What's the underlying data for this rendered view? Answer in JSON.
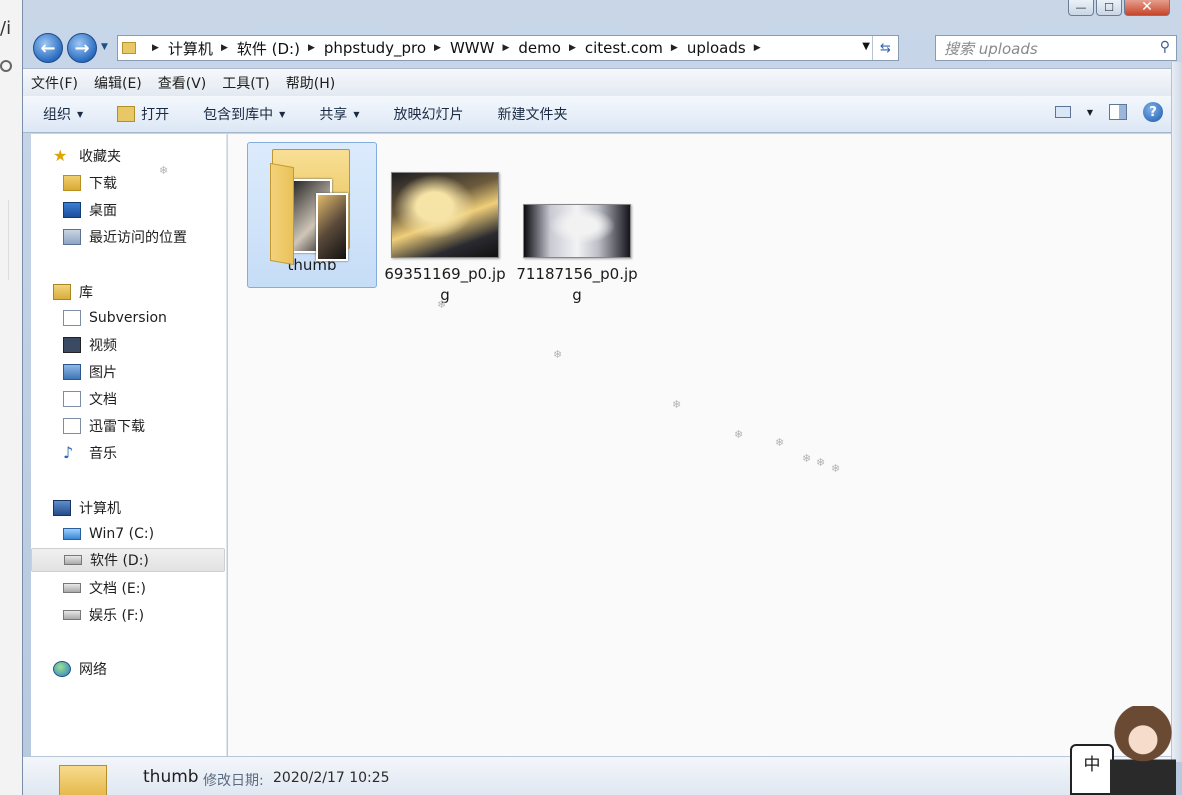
{
  "window": {
    "caption": {
      "minimize": "—",
      "maximize": "☐",
      "close": "✕"
    }
  },
  "address": {
    "crumbs": [
      "计算机",
      "软件 (D:)",
      "phpstudy_pro",
      "WWW",
      "demo",
      "citest.com",
      "uploads"
    ],
    "search_placeholder": "搜索 uploads"
  },
  "menu": {
    "items": [
      "文件(F)",
      "编辑(E)",
      "查看(V)",
      "工具(T)",
      "帮助(H)"
    ]
  },
  "commands": {
    "organize": "组织",
    "open": "打开",
    "include_library": "包含到库中",
    "share": "共享",
    "slideshow": "放映幻灯片",
    "new_folder": "新建文件夹"
  },
  "nav": {
    "favorites": {
      "title": "收藏夹",
      "items": [
        "下载",
        "桌面",
        "最近访问的位置"
      ]
    },
    "libraries": {
      "title": "库",
      "items": [
        "Subversion",
        "视频",
        "图片",
        "文档",
        "迅雷下载",
        "音乐"
      ]
    },
    "computer": {
      "title": "计算机",
      "items": [
        "Win7 (C:)",
        "软件 (D:)",
        "文档 (E:)",
        "娱乐 (F:)"
      ],
      "selected": "软件 (D:)"
    },
    "network": {
      "title": "网络"
    }
  },
  "files": [
    {
      "name": "thumb",
      "type": "folder",
      "selected": true
    },
    {
      "name": "69351169_p0.jpg",
      "type": "image"
    },
    {
      "name": "71187156_p0.jpg",
      "type": "image"
    }
  ],
  "details": {
    "name": "thumb",
    "modified_label": "修改日期:",
    "modified_value": "2020/2/17 10:25"
  },
  "ime": {
    "label": "中"
  },
  "icons": {
    "back": "arrow-left-icon",
    "forward": "arrow-right-icon",
    "refresh": "refresh-icon",
    "search": "search-icon",
    "help": "help-icon"
  }
}
